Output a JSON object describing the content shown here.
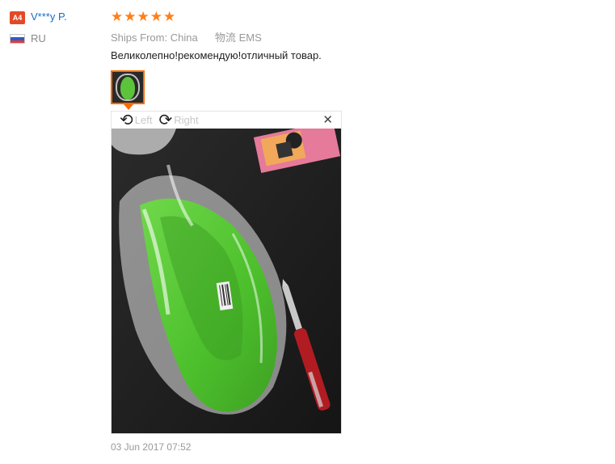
{
  "reviewer": {
    "level_badge": "A4",
    "name": "V***y P.",
    "country": "RU"
  },
  "rating": {
    "stars": 5,
    "max": 5,
    "color": "#ff7f1a"
  },
  "shipping": {
    "ships_from_label": "Ships From:",
    "ships_from_value": "China",
    "logistics_label": "物流",
    "logistics_value": "EMS"
  },
  "review_text": "Великолепно!рекомендую!отличный товар.",
  "viewer": {
    "rotate_left_label": "Left",
    "rotate_right_label": "Right",
    "rotate_left_icon": "rotate-left-icon",
    "rotate_right_icon": "rotate-right-icon",
    "close_icon": "close-icon",
    "close_glyph": "✕"
  },
  "date": "03 Jun 2017 07:52",
  "colors": {
    "accent": "#ff6a00",
    "link": "#1a6ec3",
    "badge": "#e24a26"
  }
}
